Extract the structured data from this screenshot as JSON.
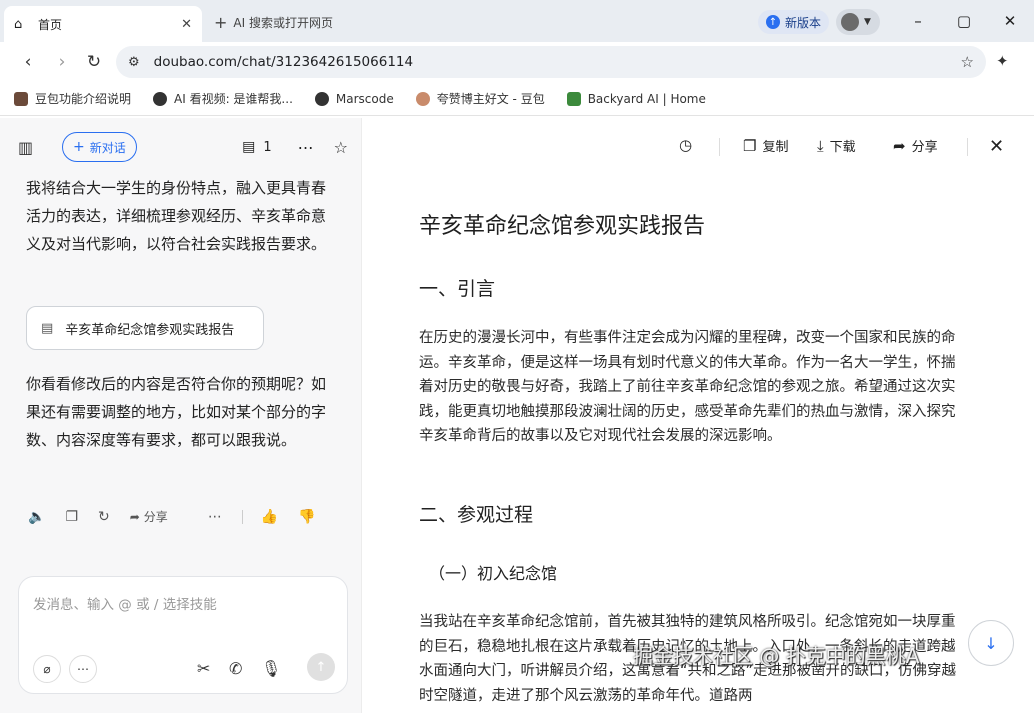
{
  "browser": {
    "active_tab": {
      "title": "首页",
      "icon": "home-icon"
    },
    "new_tab_label": "AI 搜索或打开网页",
    "new_version_label": "新版本",
    "url": "doubao.com/chat/3123642615066114",
    "window_controls": {
      "minimize": "–",
      "maximize": "▢",
      "close": "✕"
    }
  },
  "bookmarks": [
    {
      "label": "豆包功能介绍说明",
      "icon": "doubao-icon",
      "color": "#6b4a3a"
    },
    {
      "label": "AI 看视频: 是谁帮我...",
      "icon": "globe-icon",
      "color": "#333333"
    },
    {
      "label": "Marscode",
      "icon": "globe-icon",
      "color": "#333333"
    },
    {
      "label": "夸赞博主好文 - 豆包",
      "icon": "avatar-icon",
      "color": "#c98b6b"
    },
    {
      "label": "Backyard AI | Home",
      "icon": "backyard-icon",
      "color": "#3c8a3c"
    }
  ],
  "left": {
    "new_chat_label": "新对话",
    "doc_count": "1",
    "messages": {
      "intro": "我将结合大一学生的身份特点，融入更具青春活力的表达，详细梳理参观经历、辛亥革命意义及对当代影响，以符合社会实践报告要求。",
      "doc_card": "辛亥革命纪念馆参观实践报告",
      "followup": "你看看修改后的内容是否符合你的预期呢？如果还有需要调整的地方，比如对某个部分的字数、内容深度等有要求，都可以跟我说。"
    },
    "share_label": "分享",
    "input_placeholder": "发消息、输入 @ 或 / 选择技能"
  },
  "right": {
    "copy_label": "复制",
    "download_label": "下载",
    "share_label": "分享",
    "doc": {
      "title": "辛亥革命纪念馆参观实践报告",
      "h_intro": "一、引言",
      "p_intro": "在历史的漫漫长河中，有些事件注定会成为闪耀的里程碑，改变一个国家和民族的命运。辛亥革命，便是这样一场具有划时代意义的伟大革命。作为一名大一学生，怀揣着对历史的敬畏与好奇，我踏上了前往辛亥革命纪念馆的参观之旅。希望通过这次实践，能更真切地触摸那段波澜壮阔的历史，感受革命先辈们的热血与激情，深入探究辛亥革命背后的故事以及它对现代社会发展的深远影响。",
      "h_process": "二、参观过程",
      "h_enter": "（一）初入纪念馆",
      "p_enter": "当我站在辛亥革命纪念馆前，首先被其独特的建筑风格所吸引。纪念馆宛如一块厚重的巨石，稳稳地扎根在这片承载着历史记忆的土地上。入口处，一条斜长的走道跨越水面通向大门，听讲解员介绍，这寓意着“共和之路”走进那被凿开的缺口，仿佛穿越时空隧道，走进了那个风云激荡的革命年代。道路两"
    },
    "watermark": "掘金技术社区 @ 扑克中的黑桃A"
  },
  "colors": {
    "accent": "#2a6ff0",
    "panel_bg": "#f7f7f8",
    "chrome_bg": "#e9edf2"
  }
}
